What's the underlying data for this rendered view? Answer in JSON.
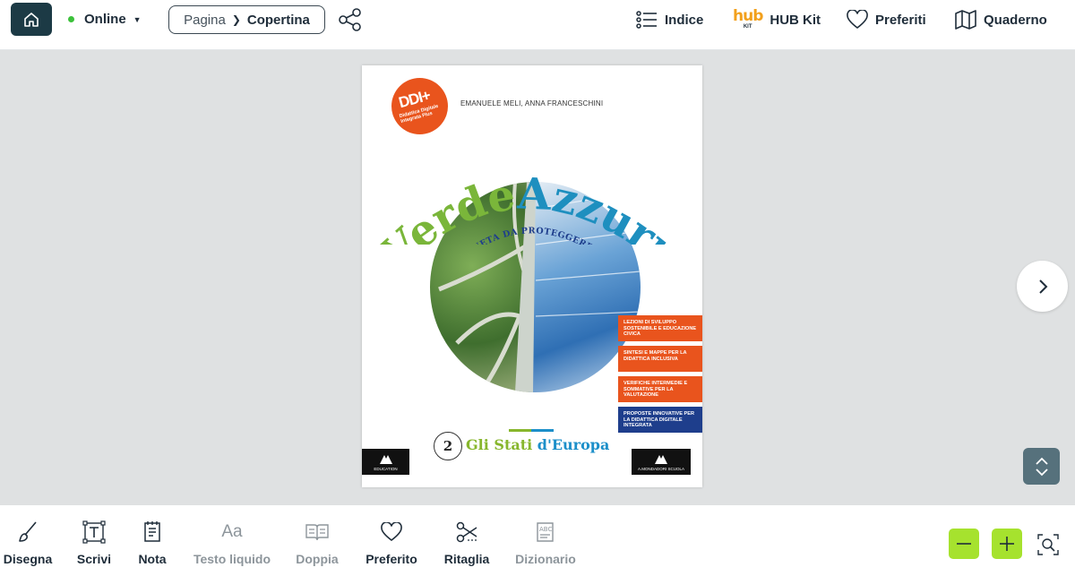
{
  "header": {
    "status_label": "Online",
    "page_prefix": "Pagina",
    "page_value": "Copertina",
    "actions": {
      "index": "Indice",
      "hubkit": "HUB Kit",
      "hub_logo": "hub",
      "hub_logo_kit": "KIT",
      "favorites": "Preferiti",
      "notebook": "Quaderno"
    }
  },
  "cover": {
    "badge_big": "DDI+",
    "badge_small": "Didattica Digitale Integrata Plus",
    "authors": "EMANUELE MELI, ANNA FRANCESCHINI",
    "title_verde": "Verde",
    "title_azzurro": "Azzurro",
    "subtitle": "UN PIANETA DA PROTEGGERE",
    "features": [
      {
        "text": "LEZIONI DI SVILUPPO SOSTENIBILE E EDUCAZIONE CIVICA",
        "color": "#e9541d"
      },
      {
        "text": "SINTESI E MAPPE PER LA DIDATTICA INCLUSIVA",
        "color": "#e9541d"
      },
      {
        "text": "VERIFICHE INTERMEDIE E SOMMATIVE PER LA VALUTAZIONE",
        "color": "#e9541d"
      },
      {
        "text": "PROPOSTE INNOVATIVE PER LA DIDATTICA DIGITALE INTEGRATA",
        "color": "#1e3e8c"
      }
    ],
    "volume_number": "2",
    "volume_title_a": "Gli Stati",
    "volume_title_b": "d'Europa",
    "publisher_left": "EDUCATION",
    "publisher_right": "A.MONDADORI SCUOLA"
  },
  "toolbar": {
    "tools": [
      {
        "label": "Disegna",
        "icon": "brush-icon",
        "enabled": true
      },
      {
        "label": "Scrivi",
        "icon": "text-box-icon",
        "enabled": true
      },
      {
        "label": "Nota",
        "icon": "note-icon",
        "enabled": true
      },
      {
        "label": "Testo liquido",
        "icon": "font-aa-icon",
        "enabled": false
      },
      {
        "label": "Doppia",
        "icon": "open-book-icon",
        "enabled": false
      },
      {
        "label": "Preferito",
        "icon": "heart-icon",
        "enabled": true
      },
      {
        "label": "Ritaglia",
        "icon": "scissors-icon",
        "enabled": true
      },
      {
        "label": "Dizionario",
        "icon": "dictionary-icon",
        "enabled": false
      }
    ]
  },
  "colors": {
    "accent_dark": "#1c3a45",
    "online_green": "#3cc13b",
    "zoom_green": "#a6e22e",
    "scroll_btn": "#56717c"
  }
}
